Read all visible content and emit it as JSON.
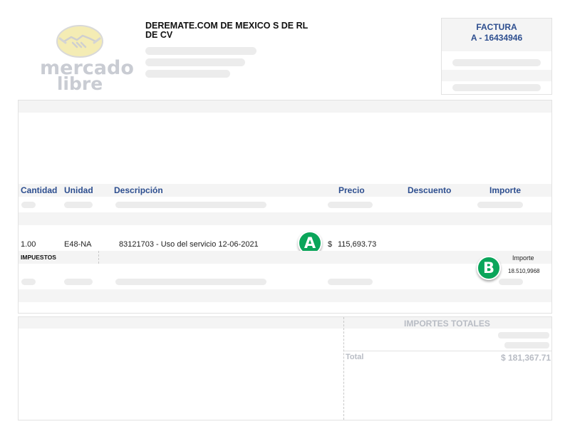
{
  "logo": {
    "line1": "mercado",
    "line2": "libre",
    "icon": "handshake-icon"
  },
  "company": {
    "name": "DEREMATE.COM DE MEXICO S DE RL DE CV"
  },
  "factura": {
    "title": "FACTURA",
    "number": "A - 16434946"
  },
  "table": {
    "headers": {
      "cantidad": "Cantidad",
      "unidad": "Unidad",
      "descripcion": "Descripción",
      "precio": "Precio",
      "descuento": "Descuento",
      "importe": "Importe"
    },
    "row": {
      "cantidad": "1.00",
      "unidad": "E48-NA",
      "descripcion": "83121703 - Uso del servicio 12-06-2021",
      "currency": "$",
      "precio": "115,693.73"
    },
    "impuestos": {
      "label": "IMPUESTOS",
      "importe_label": "Importe",
      "importe_value": "18.510,9968"
    }
  },
  "badges": {
    "a": "A",
    "b": "B"
  },
  "totals": {
    "title": "IMPORTES TOTALES",
    "total_label": "Total",
    "total_value": "$ 181,367.71"
  },
  "colors": {
    "header_blue": "#2d4e8f",
    "badge_green": "#0aa55a",
    "placeholder": "#ececec"
  }
}
